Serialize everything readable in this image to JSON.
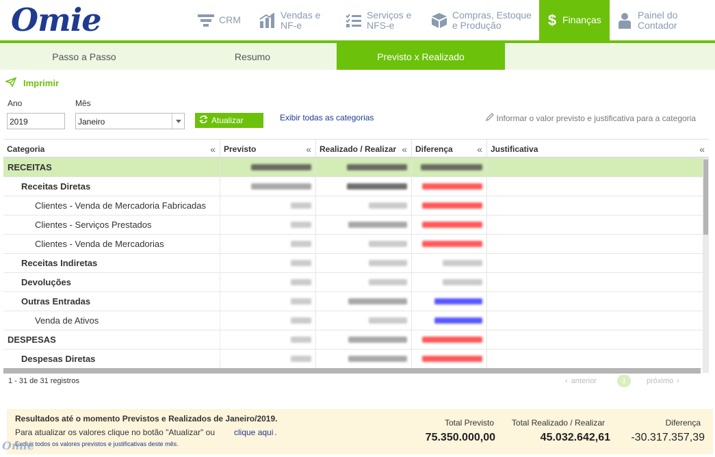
{
  "brand": {
    "logo": "Omie",
    "accent": "#6cc10a",
    "navy": "#1f3b8f"
  },
  "nav": [
    {
      "id": "crm",
      "icon": "funnel-icon",
      "label": "CRM"
    },
    {
      "id": "vendas",
      "icon": "bar-chart-icon",
      "label1": "Vendas e",
      "label2": "NF-e"
    },
    {
      "id": "servicos",
      "icon": "checklist-icon",
      "label1": "Serviços e",
      "label2": "NFS-e"
    },
    {
      "id": "compras",
      "icon": "box-icon",
      "label1": "Compras, Estoque",
      "label2": "e Produção"
    },
    {
      "id": "financas",
      "icon": "dollar-icon",
      "label": "Finanças",
      "active": true
    },
    {
      "id": "contador",
      "icon": "person-icon",
      "label1": "Painel do",
      "label2": "Contador"
    }
  ],
  "tabs": [
    {
      "label": "Passo a Passo"
    },
    {
      "label": "Resumo"
    },
    {
      "label": "Previsto x Realizado",
      "active": true
    }
  ],
  "toolbar": {
    "print_label": "Imprimir",
    "year_label": "Ano",
    "year_value": "2019",
    "month_label": "Mês",
    "month_value": "Janeiro",
    "update_label": "Atualizar",
    "show_all_label": "Exibir todas as categorias",
    "hint": "Informar o valor previsto e justificativa para a categoria"
  },
  "table": {
    "columns": [
      "Categoria",
      "Previsto",
      "Realizado / Realizar",
      "Diferença",
      "Justificativa"
    ],
    "collapse_glyph": "«",
    "rows": [
      {
        "label": "RECEITAS",
        "level": 0,
        "highlight": true,
        "prev": "dark",
        "real": "dark",
        "diff": "dark"
      },
      {
        "label": "Receitas Diretas",
        "level": 1,
        "prev": "gray",
        "real": "dark",
        "diff": "red"
      },
      {
        "label": "Clientes - Venda de Mercadoria Fabricadas",
        "level": 2,
        "prev": "light",
        "real": "light",
        "diff": "red"
      },
      {
        "label": "Clientes - Serviços Prestados",
        "level": 2,
        "prev": "light",
        "real": "gray",
        "diff": "red"
      },
      {
        "label": "Clientes - Venda de Mercadorias",
        "level": 2,
        "prev": "light",
        "real": "light",
        "diff": "red"
      },
      {
        "label": "Receitas Indiretas",
        "level": 1,
        "prev": "light",
        "real": "light",
        "diff": "light"
      },
      {
        "label": "Devoluções",
        "level": 1,
        "prev": "light",
        "real": "light",
        "diff": "light"
      },
      {
        "label": "Outras Entradas",
        "level": 1,
        "prev": "light",
        "real": "gray",
        "diff": "blue"
      },
      {
        "label": "Venda de Ativos",
        "level": 2,
        "prev": "light",
        "real": "light",
        "diff": "blue"
      },
      {
        "label": "DESPESAS",
        "level": 0,
        "prev": "light",
        "real": "gray",
        "diff": "red"
      },
      {
        "label": "Despesas Diretas",
        "level": 1,
        "prev": "light",
        "real": "gray",
        "diff": "red"
      }
    ]
  },
  "footer": {
    "records": "1 - 31 de 31 registros",
    "prev_label": "anterior",
    "next_label": "próximo",
    "page": "1"
  },
  "summary": {
    "title": "Resultados até o momento Previstos e Realizados de Janeiro/2019.",
    "subtitle": "Para atualizar os valores clique no botão \"Atualizar\" ou",
    "click_here": "clique aqui",
    "period": ".",
    "exclude": "Excluir todos os valores previstos e justificativas deste mês.",
    "total_prev_label": "Total Previsto",
    "total_prev": "75.350.000,00",
    "total_real_label": "Total Realizado / Realizar",
    "total_real": "45.032.642,61",
    "diff_label": "Diferença",
    "diff": "-30.317.357,39"
  }
}
